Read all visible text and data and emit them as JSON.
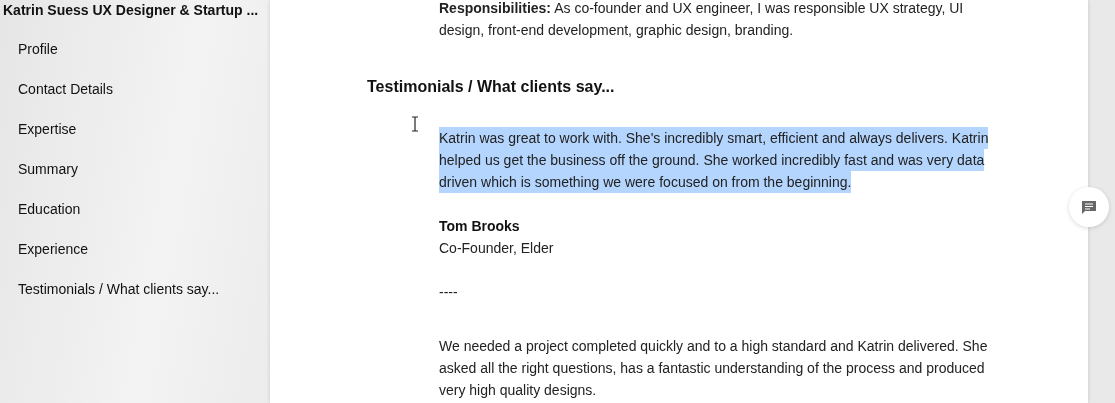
{
  "outline": {
    "title": "Katrin Suess UX Designer & Startup ...",
    "items": [
      {
        "label": "Profile"
      },
      {
        "label": "Contact Details"
      },
      {
        "label": "Expertise"
      },
      {
        "label": "Summary"
      },
      {
        "label": "Education"
      },
      {
        "label": "Experience"
      },
      {
        "label": "Testimonials / What clients say..."
      }
    ]
  },
  "document": {
    "responsibilities": "**Responsibilities:** As co-founder and UX engineer, I was responsible UX strategy, UI design, front-end development, graphic design, branding.",
    "heading": "Testimonials / What clients say...",
    "testimonials": [
      {
        "quote": "Katrin was great to work with. She's incredibly smart, efficient and always delivers. Katrin helped us get the business off the ground. She worked incredibly fast and was very data driven which is something we were focused on from the beginning.",
        "highlighted": true,
        "name": "Tom Brooks",
        "role": "Co-Founder, Elder",
        "separator": "----"
      },
      {
        "quote": "We needed a project completed quickly and to a high standard and Katrin delivered. She asked all the right questions, has a fantastic understanding of the process and produced very high quality designs.",
        "highlighted": false
      }
    ]
  }
}
